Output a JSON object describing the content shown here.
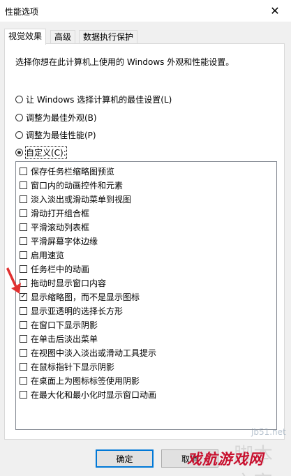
{
  "window": {
    "title": "性能选项"
  },
  "tabs": [
    {
      "label": "视觉效果"
    },
    {
      "label": "高级"
    },
    {
      "label": "数据执行保护"
    }
  ],
  "description": "选择你想在此计算机上使用的 Windows 外观和性能设置。",
  "radios": [
    {
      "label": "让 Windows 选择计算机的最佳设置(L)",
      "checked": false
    },
    {
      "label": "调整为最佳外观(B)",
      "checked": false
    },
    {
      "label": "调整为最佳性能(P)",
      "checked": false
    },
    {
      "label": "自定义(C):",
      "checked": true
    }
  ],
  "options": [
    {
      "label": "保存任务栏缩略图预览",
      "checked": false
    },
    {
      "label": "窗口内的动画控件和元素",
      "checked": false
    },
    {
      "label": "淡入淡出或滑动菜单到视图",
      "checked": false
    },
    {
      "label": "滑动打开组合框",
      "checked": false
    },
    {
      "label": "平滑滚动列表框",
      "checked": false
    },
    {
      "label": "平滑屏幕字体边缘",
      "checked": false
    },
    {
      "label": "启用速览",
      "checked": false
    },
    {
      "label": "任务栏中的动画",
      "checked": false
    },
    {
      "label": "拖动时显示窗口内容",
      "checked": false
    },
    {
      "label": "显示缩略图，而不是显示图标",
      "checked": true
    },
    {
      "label": "显示亚透明的选择长方形",
      "checked": false
    },
    {
      "label": "在窗口下显示阴影",
      "checked": false
    },
    {
      "label": "在单击后淡出菜单",
      "checked": false
    },
    {
      "label": "在视图中淡入淡出或滑动工具提示",
      "checked": false
    },
    {
      "label": "在鼠标指针下显示阴影",
      "checked": false
    },
    {
      "label": "在桌面上为图标标签使用阴影",
      "checked": false
    },
    {
      "label": "在最大化和最小化时显示窗口动画",
      "checked": false
    }
  ],
  "buttons": {
    "ok": "确定",
    "cancel": "取消"
  },
  "watermarks": {
    "site": "jb51.net",
    "red": "戏航游戏网",
    "gray": "脚本之家"
  },
  "colors": {
    "arrow": "#e03030",
    "default_button_border": "#0078d7",
    "watermark_red": "#c8102e"
  }
}
